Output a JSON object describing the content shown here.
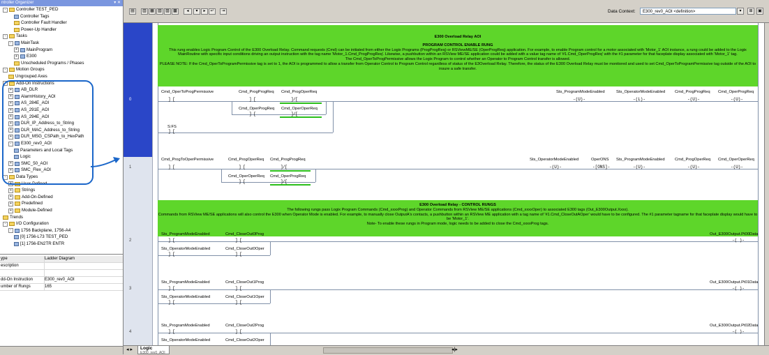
{
  "left_panel": {
    "title": "ntroller Organizer",
    "tree": [
      {
        "label": "Controller TEST_PED",
        "indent": 0,
        "pm": "-",
        "icon": "folder"
      },
      {
        "label": "Controller Tags",
        "indent": 2,
        "pm": "",
        "icon": "item"
      },
      {
        "label": "Controller Fault Handler",
        "indent": 2,
        "pm": "",
        "icon": "folder"
      },
      {
        "label": "Power-Up Handler",
        "indent": 2,
        "pm": "",
        "icon": "folder"
      },
      {
        "label": "Tasks",
        "indent": 0,
        "pm": "-",
        "icon": "folder"
      },
      {
        "label": "MainTask",
        "indent": 1,
        "pm": "-",
        "icon": "item"
      },
      {
        "label": "MainProgram",
        "indent": 2,
        "pm": "+",
        "icon": "item"
      },
      {
        "label": "E300",
        "indent": 2,
        "pm": "+",
        "icon": "item"
      },
      {
        "label": "Unscheduled Programs / Phases",
        "indent": 2,
        "pm": "",
        "icon": "folder"
      },
      {
        "label": "Motion Groups",
        "indent": 0,
        "pm": "-",
        "icon": "folder"
      },
      {
        "label": "Ungrouped Axes",
        "indent": 1,
        "pm": "",
        "icon": "folder"
      },
      {
        "label": "Add-On Instructions",
        "indent": 0,
        "pm": "-",
        "icon": "folder"
      },
      {
        "label": "AB_DLR",
        "indent": 1,
        "pm": "+",
        "icon": "item"
      },
      {
        "label": "AlarmHistory_AOI",
        "indent": 1,
        "pm": "+",
        "icon": "item"
      },
      {
        "label": "AS_284E_AOI",
        "indent": 1,
        "pm": "+",
        "icon": "item"
      },
      {
        "label": "AS_291E_AOI",
        "indent": 1,
        "pm": "+",
        "icon": "item"
      },
      {
        "label": "AS_294E_AOI",
        "indent": 1,
        "pm": "+",
        "icon": "item"
      },
      {
        "label": "DLR_IP_Address_to_String",
        "indent": 1,
        "pm": "+",
        "icon": "item"
      },
      {
        "label": "DLR_MAC_Address_to_String",
        "indent": 1,
        "pm": "+",
        "icon": "item"
      },
      {
        "label": "DLR_MSG_CSPath_to_HexPath",
        "indent": 1,
        "pm": "+",
        "icon": "item"
      },
      {
        "label": "E300_rev0_AOI",
        "indent": 1,
        "pm": "-",
        "icon": "item"
      },
      {
        "label": "Parameters and Local Tags",
        "indent": 2,
        "pm": "",
        "icon": "item"
      },
      {
        "label": "Logic",
        "indent": 2,
        "pm": "",
        "icon": "item"
      },
      {
        "label": "SMC_50_AOI",
        "indent": 1,
        "pm": "+",
        "icon": "item"
      },
      {
        "label": "SMC_Flex_AOI",
        "indent": 1,
        "pm": "+",
        "icon": "item"
      },
      {
        "label": "Data Types",
        "indent": 0,
        "pm": "-",
        "icon": "folder"
      },
      {
        "label": "User-Defined",
        "indent": 1,
        "pm": "+",
        "icon": "folder"
      },
      {
        "label": "Strings",
        "indent": 1,
        "pm": "+",
        "icon": "folder"
      },
      {
        "label": "Add-On-Defined",
        "indent": 1,
        "pm": "+",
        "icon": "folder"
      },
      {
        "label": "Predefined",
        "indent": 1,
        "pm": "+",
        "icon": "folder"
      },
      {
        "label": "Module-Defined",
        "indent": 1,
        "pm": "+",
        "icon": "folder"
      },
      {
        "label": "Trends",
        "indent": 0,
        "pm": "",
        "icon": "folder"
      },
      {
        "label": "I/O Configuration",
        "indent": 0,
        "pm": "-",
        "icon": "folder"
      },
      {
        "label": "1756 Backplane, 1756-A4",
        "indent": 1,
        "pm": "-",
        "icon": "item"
      },
      {
        "label": "[0] 1756-L73 TEST_PED",
        "indent": 2,
        "pm": "",
        "icon": "item"
      },
      {
        "label": "[1] 1756-EN2TR ENTR",
        "indent": 2,
        "pm": "",
        "icon": "item"
      }
    ],
    "properties": [
      {
        "k": "ype",
        "v": "Ladder Diagram",
        "head": true
      },
      {
        "k": "escription",
        "v": "",
        "head": false
      },
      {
        "k": "",
        "v": "",
        "head": false
      },
      {
        "k": "dd-On Instruction",
        "v": "E300_rev0_AOI",
        "head": false
      },
      {
        "k": "umber of Rungs",
        "v": "165",
        "head": false
      }
    ]
  },
  "toolbar": {
    "data_context_label": "Data Context:",
    "data_context_value": "E300_rev0_AOI <definition>"
  },
  "bottom": {
    "tab_label": "Logic",
    "tab_sub": "E300_rev0_AOI"
  },
  "rungs": [
    {
      "number": "0"
    },
    {
      "number": "1"
    },
    {
      "number": "2"
    },
    {
      "number": "3"
    },
    {
      "number": "4"
    }
  ],
  "comments": {
    "c1": {
      "title": "E300 Overload Relay AOI",
      "subtitle": "PROGRAM CONTROL ENABLE RUNG",
      "body1": "This rung enables Logic Program Control of the E300 Overload Relay.  Command requests (Cmd) can be initiated from either the Logix Programs (ProgProgReq) or RSViewME/SE (OperProgReq) application.  For example, to enable Program control for a motor associated with 'Motor_1' AOI instance, a rung could be added to the Logix MainRoutine with specific input conditions driving an output instruction with the tag name 'Motor_1.Cmd_ProgProgReq'.  Likewise, a pushbutton within an RSView ME/SE application could be added with a value tag name of '#1.Cmd_OperProgReq' with the #1 parameter for that faceplate display associated with 'Motor_1' tag.",
      "body2": "The Cmd_OperToProgPermissive allows the Logix Program to control whether an Operator to Program Control transfer is allowed.",
      "body3": "PLEASE NOTE: If the Cmd_OperToProgramPermissive tag is set to 1, the AOI is programmed to allow a transfer from Operator Control to Program Control regardless of status of the E3Overload Relay.  Therefore, the status of the E300 Overload Relay must be monitored and used to set Cmd_OperToProgramPermissive tag outside of the AOI to insure a safe transfer."
    },
    "c2": {
      "title": "E300 Overload Relay - CONTROL RUNGS",
      "body1": "The following rungs pass Logix Program Commands (Cmd_xxxxProg) and Operator Commands from RSView ME/SE applications (Cmd_xxxxOper) to associated E300 tags (Out_E300Output.Xxxx).",
      "body2": "Commands from RSView ME/SE applications will also control the E300 when Operator Mode is enabled.  For example, to manually close OutputA's contacts, a pushbutton within an RSView ME application with a tag name of '#1.Cmd_CloseOutAOper' would have to be configured.  The #1 parameter tagname for that faceplate display would have to be 'Motor_1'.",
      "body3": "Note- To enable these rungs in Program mode, logic needs to be added to close the Cmd_xxxxProg tags."
    }
  },
  "ladder": {
    "r0": {
      "c1": "Cmd_OperToProgPermissive",
      "c2": "Cmd_ProgProgReq",
      "c3": "Cmd_ProgOperReq",
      "c4": "Cmd_OperProgReq",
      "c5": "Cmd_OperOperReq",
      "c6": "S:FS",
      "o1": "Sts_ProgramModeEnabled",
      "o2": "Sts_OperatorModeEnabled",
      "o3": "Cmd_ProgProgReq",
      "o4": "Cmd_OperProgReq"
    },
    "r1": {
      "c1": "Cmd_ProgToOperPermissive",
      "c2": "Cmd_ProgOperReq",
      "c3": "Cmd_ProgProgReq",
      "c4": "Cmd_OperOperReq",
      "c5": "Cmd_OperProgReq",
      "o1": "Sts_OperatorModeEnabled",
      "o2": "OperONS",
      "o3": "Sts_ProgramModeEnabled",
      "o4": "Cmd_ProgOperReq",
      "o5": "Cmd_OperOperReq"
    },
    "r2": {
      "a": "Sts_ProgramModeEnabled",
      "b": "Cmd_CloseOut0Prog",
      "c": "Sts_OperatorModeEnabled",
      "d": "Cmd_CloseOut0Oper",
      "out": "Out_E300Output.Pt00Data"
    },
    "r3": {
      "a": "Sts_ProgramModeEnabled",
      "b": "Cmd_CloseOut1Prog",
      "c": "Sts_OperatorModeEnabled",
      "d": "Cmd_CloseOut1Oper",
      "out": "Out_E300Output.Pt01Data"
    },
    "r4": {
      "a": "Sts_ProgramModeEnabled",
      "b": "Cmd_CloseOut2Prog",
      "c": "Sts_OperatorModeEnabled",
      "d": "Cmd_CloseOut2Oper",
      "out": "Out_E300Output.Pt02Data"
    }
  },
  "colors": {
    "comment_bg": "#5ed62a",
    "selection": "#2a46c8",
    "highlight": "#1a66c9"
  }
}
